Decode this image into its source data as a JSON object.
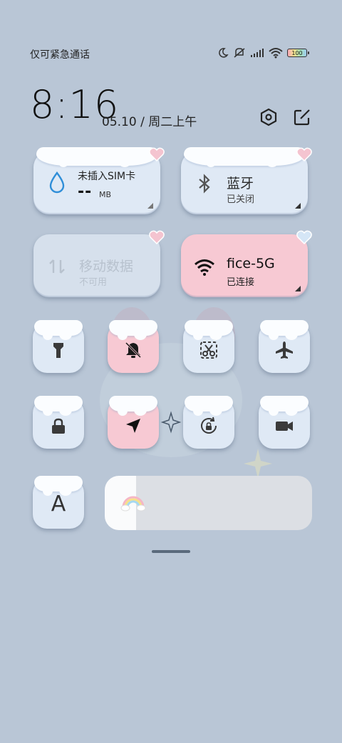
{
  "status_bar": {
    "carrier_text": "仅可紧急通话",
    "icons": [
      "moon-icon",
      "mute-vibrate-icon",
      "signal-icon",
      "wifi-icon",
      "battery-icon"
    ],
    "battery_label": "100"
  },
  "header": {
    "time": "8:16",
    "date": "05.10 / 周二上午",
    "settings_icon": "hexagon-settings-icon",
    "edit_icon": "edit-icon"
  },
  "tiles": {
    "sim": {
      "title": "未插入SIM卡",
      "value": "--",
      "unit": "MB",
      "icon": "water-drop-icon"
    },
    "bluetooth": {
      "title": "蓝牙",
      "status": "已关闭",
      "icon": "bluetooth-icon"
    },
    "mobile_data": {
      "title": "移动数据",
      "status": "不可用",
      "icon": "data-arrows-icon"
    },
    "wifi": {
      "title": "fice-5G",
      "status": "已连接",
      "icon": "wifi-icon"
    }
  },
  "toggles": [
    {
      "name": "flashlight",
      "icon": "flashlight-icon",
      "active": false
    },
    {
      "name": "mute",
      "icon": "bell-off-icon",
      "active": true
    },
    {
      "name": "screenshot",
      "icon": "scissors-icon",
      "active": false
    },
    {
      "name": "airplane-mode",
      "icon": "airplane-icon",
      "active": false
    },
    {
      "name": "lock-screen",
      "icon": "lock-icon",
      "active": false
    },
    {
      "name": "location",
      "icon": "location-arrow-icon",
      "active": true
    },
    {
      "name": "rotation-lock",
      "icon": "rotation-lock-icon",
      "active": false
    },
    {
      "name": "screen-record",
      "icon": "video-camera-icon",
      "active": false
    }
  ],
  "font_button": {
    "label": "A"
  },
  "brightness": {
    "level_fraction": 0.15,
    "icon": "rainbow-icon"
  },
  "colors": {
    "background": "#b9c6d6",
    "tile": "#dfe9f5",
    "tile_active": "#f7c9d3"
  }
}
